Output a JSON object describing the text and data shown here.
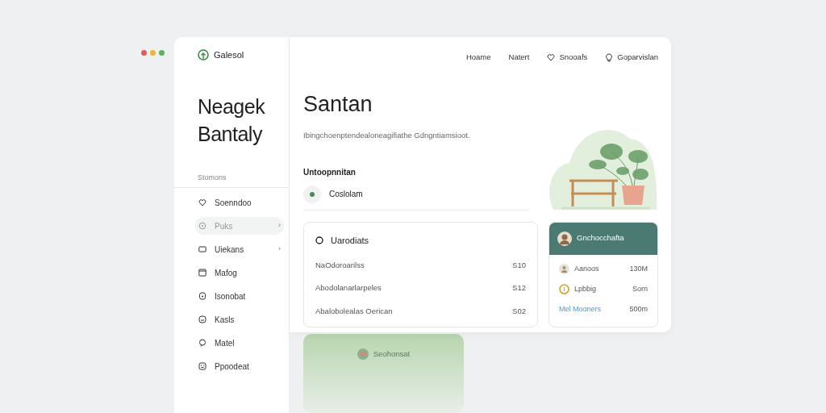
{
  "brand": {
    "name": "Galesol"
  },
  "sidebar": {
    "title": "Neagek Bantaly",
    "section": "Stomons",
    "items": [
      {
        "label": "Soenndoo",
        "selected": false
      },
      {
        "label": "Puks",
        "selected": true,
        "chevron": "›"
      },
      {
        "label": "Uiekans",
        "selected": false,
        "chevron": "›"
      },
      {
        "label": "Mafog",
        "selected": false
      },
      {
        "label": "Isonobat",
        "selected": false
      },
      {
        "label": "Kasls",
        "selected": false
      },
      {
        "label": "Matel",
        "selected": false
      },
      {
        "label": "Ppoodeat",
        "selected": false
      }
    ]
  },
  "nav": [
    {
      "label": "Hoame"
    },
    {
      "label": "Natert"
    },
    {
      "label": "Snooafs"
    },
    {
      "label": "Goparvislan"
    }
  ],
  "main": {
    "title": "Santan",
    "subtitle": "Ibingchoenptendealoneagifiathe Gdngntiamsioot.",
    "section": "Untoopnnitan",
    "option": "Coslolam"
  },
  "list_card": {
    "title": "Uarodiats",
    "rows": [
      {
        "label": "NaOdoroarilss",
        "value": "S10"
      },
      {
        "label": "Abodolanarlarpeles",
        "value": "S12"
      },
      {
        "label": "Abalobolealas Oerican",
        "value": "S02"
      }
    ]
  },
  "profile_card": {
    "title": "Gnchocchafta",
    "rows": [
      {
        "kind": "person",
        "label": "Aanoos",
        "value": "130M"
      },
      {
        "kind": "coin",
        "label": "Lpbbig",
        "value": "Sorn"
      },
      {
        "kind": "link",
        "label": "Mel Mooners",
        "value": "500m"
      }
    ]
  },
  "bottom_card": {
    "label": "Seohonsat"
  }
}
